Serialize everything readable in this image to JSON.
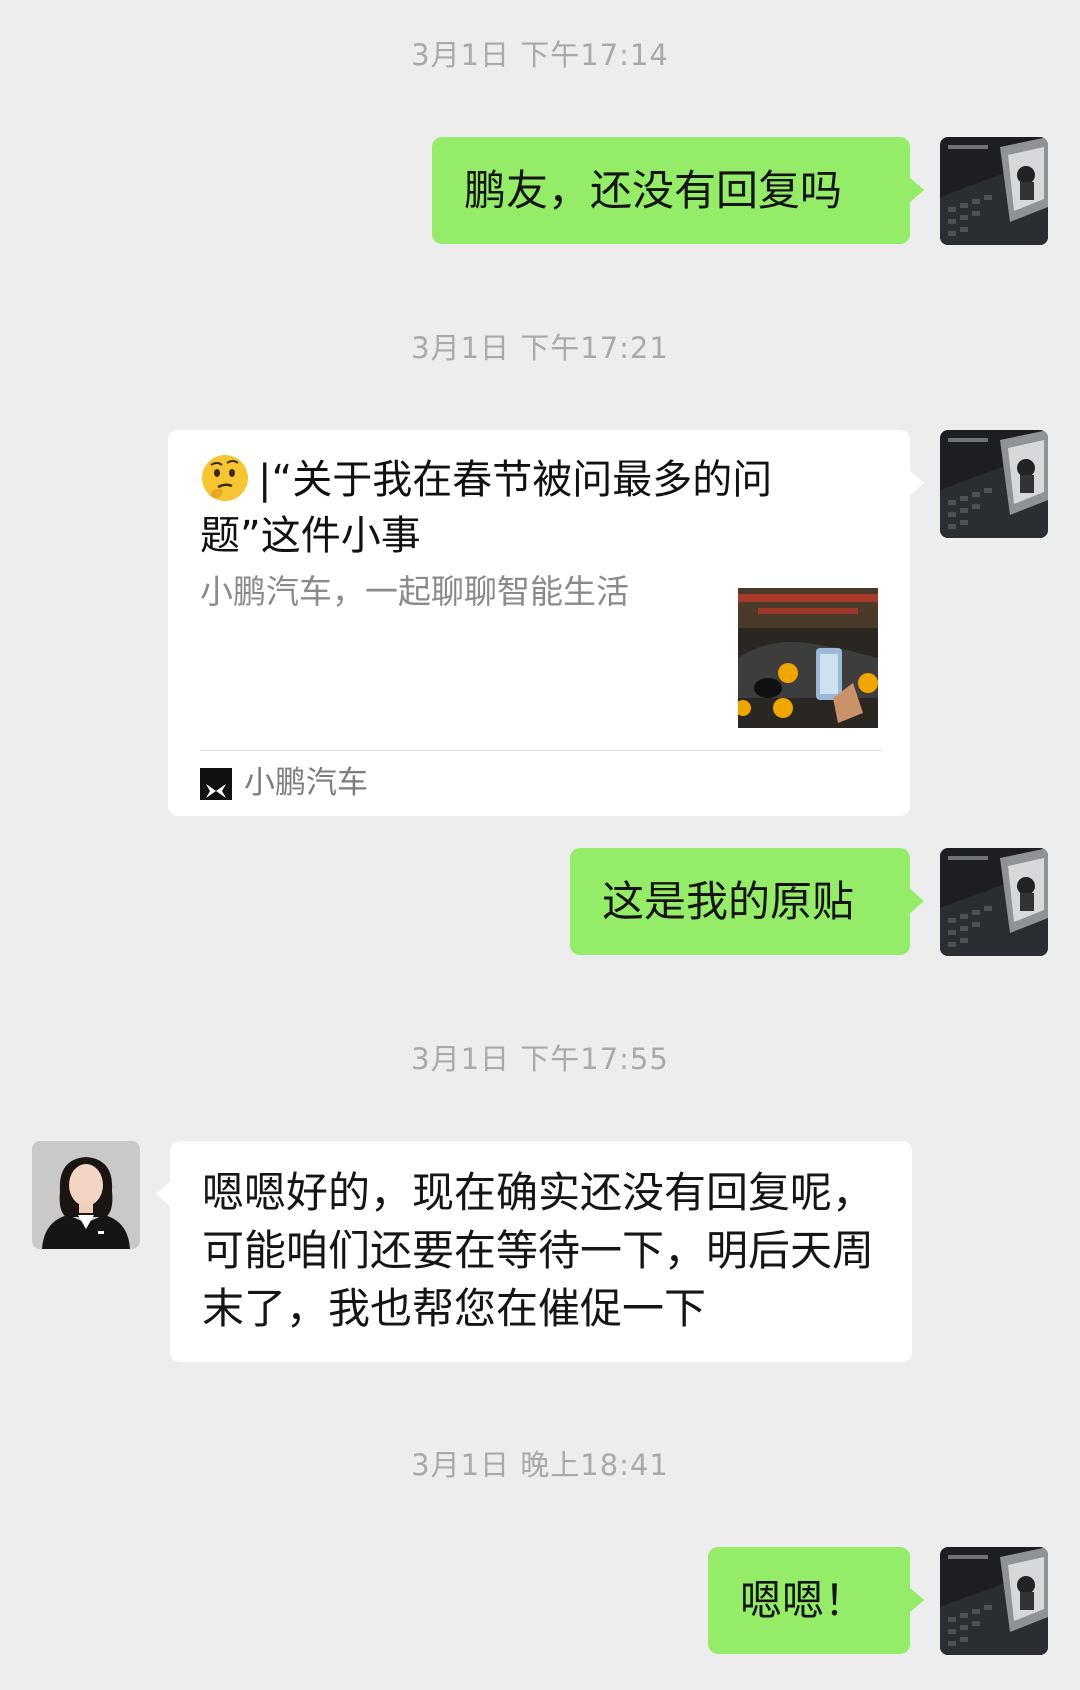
{
  "messages": {
    "ts1": "3月1日 下午17:14",
    "msg1": "鹏友，还没有回复吗",
    "ts2": "3月1日 下午17:21",
    "card": {
      "title": "|“关于我在春节被问最多的问题”这件小事",
      "description": "小鹏汽车，一起聊聊智能生活",
      "source": "小鹏汽车",
      "emoji": "thinking-face-emoji"
    },
    "msg2": "这是我的原贴",
    "ts3": "3月1日 下午17:55",
    "msg3": "嗯嗯好的，现在确实还没有回复呢，可能咱们还要在等待一下，明后天周末了，我也帮您在催促一下",
    "ts4": "3月1日 晚上18:41",
    "msg4": "嗯嗯！"
  },
  "colors": {
    "background": "#ededed",
    "sent_bubble": "#95ec69",
    "received_bubble": "#ffffff",
    "timestamp": "#a9a9a9"
  }
}
